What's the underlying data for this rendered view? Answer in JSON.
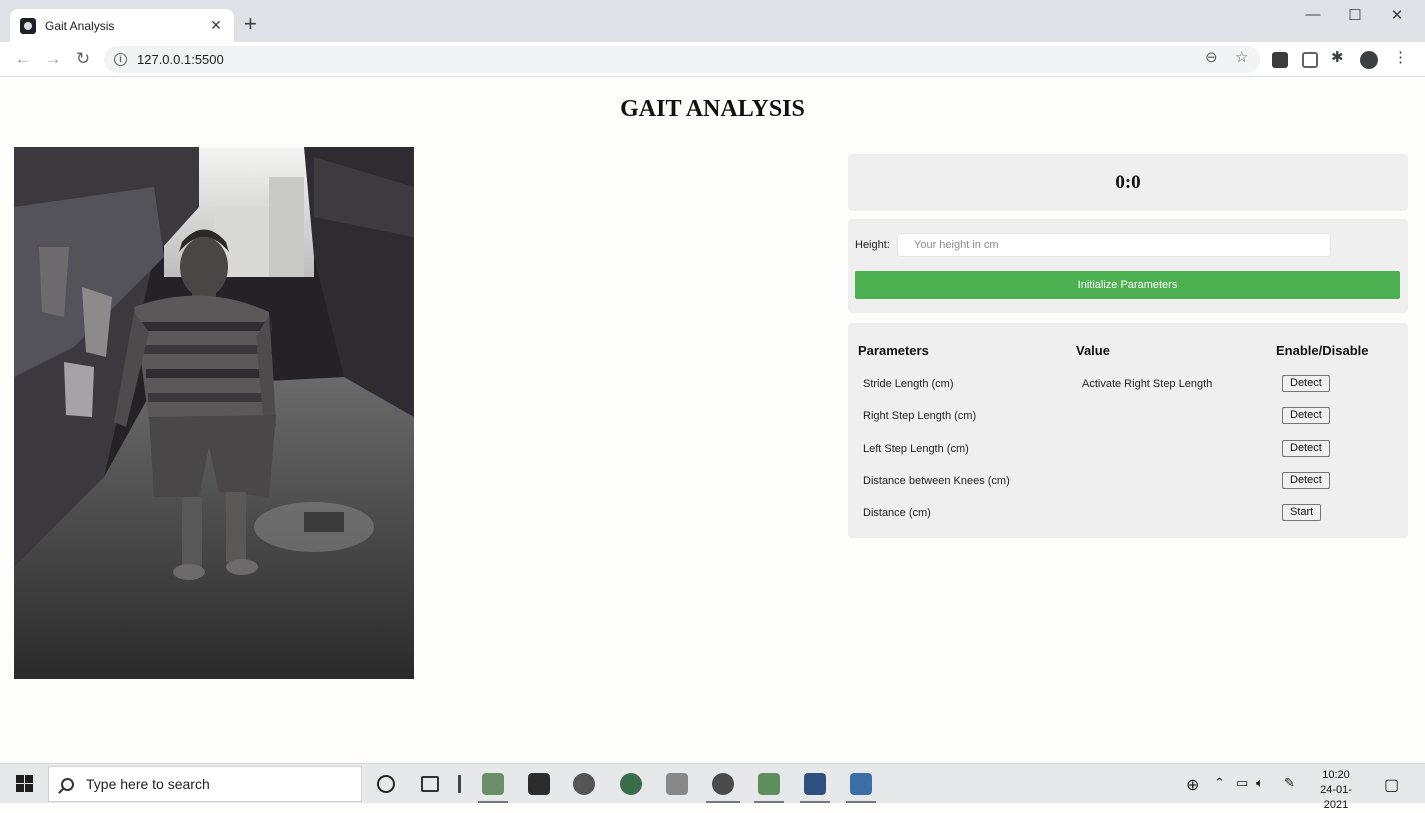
{
  "browser": {
    "tab_title": "Gait Analysis",
    "tab_close": "✕",
    "new_tab": "+",
    "url": "127.0.0.1:5500",
    "window_controls": {
      "minimize": "—",
      "maximize": "☐",
      "close": "✕"
    }
  },
  "page": {
    "title": "GAIT ANALYSIS",
    "score": "0:0",
    "form": {
      "height_label": "Height:",
      "height_placeholder": "Your height in cm",
      "height_value": "",
      "init_button": "Initialize Parameters"
    },
    "params": {
      "headers": {
        "parameters": "Parameters",
        "value": "Value",
        "toggle": "Enable/Disable"
      },
      "rows": [
        {
          "name": "Stride Length (cm)",
          "value": "Activate Right Step Length",
          "button": "Detect"
        },
        {
          "name": "Right Step Length (cm)",
          "value": "",
          "button": "Detect"
        },
        {
          "name": "Left Step Length (cm)",
          "value": "",
          "button": "Detect"
        },
        {
          "name": "Distance between Knees (cm)",
          "value": "",
          "button": "Detect"
        },
        {
          "name": "Distance (cm)",
          "value": "",
          "button": "Start"
        }
      ]
    },
    "colors": {
      "accent": "#4caf50",
      "panel_bg": "#efefef"
    }
  },
  "taskbar": {
    "search_placeholder": "Type here to search",
    "time": "10:20",
    "date": "24-01-2021"
  }
}
